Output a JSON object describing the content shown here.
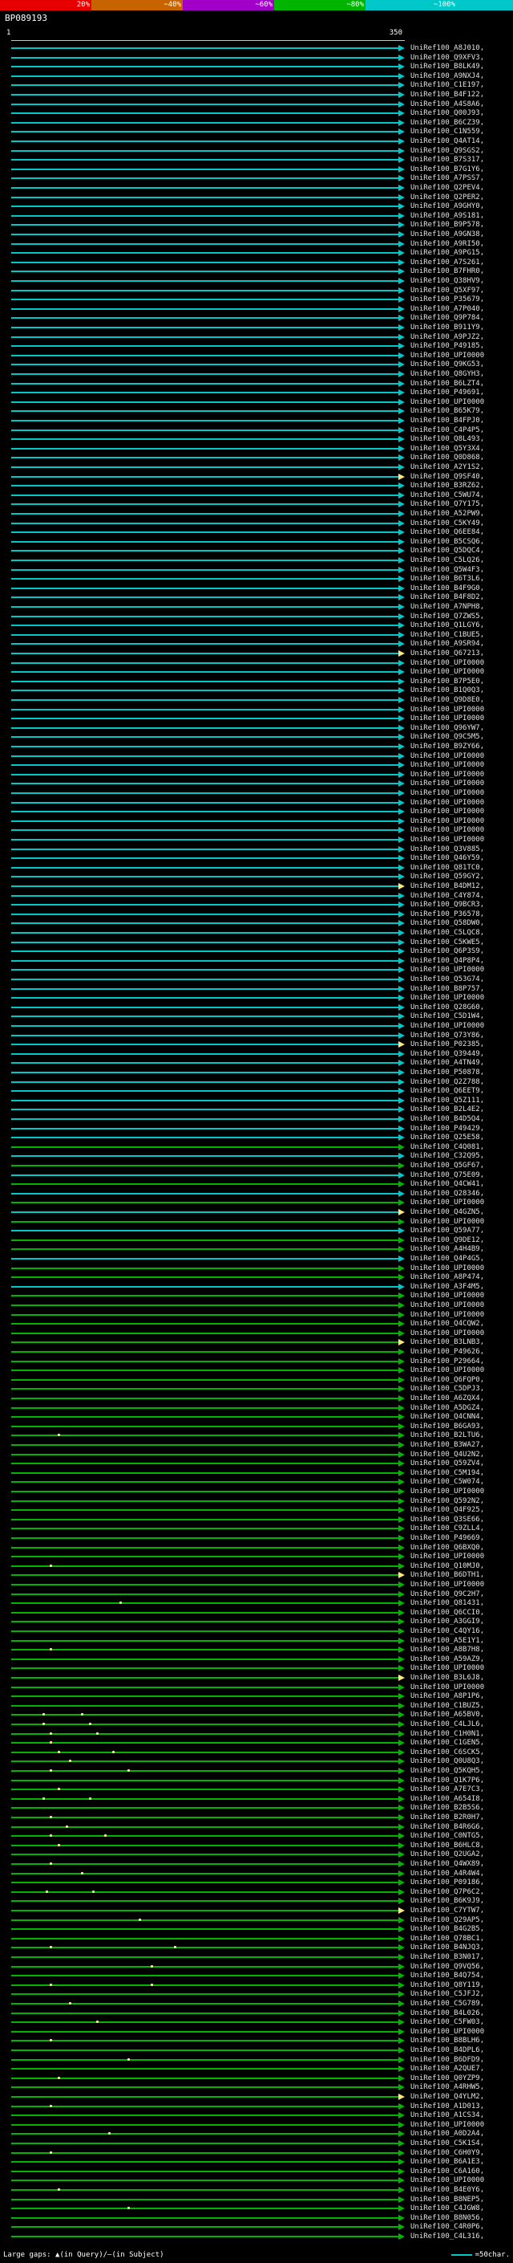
{
  "colors": {
    "c": "#00c8c8",
    "g": "#00b400",
    "highlight": "#ffe97a",
    "dot": "#f0f0a0",
    "legend_line": "#00c8c8",
    "label": "#e0e0e0"
  },
  "legend": {
    "left": "Large gaps: ▲(in Query)/—(in Subject)",
    "right_label": "=50char."
  },
  "chart_data": {
    "type": "alignment-overview",
    "query": {
      "name": "BP089193",
      "length": 350
    },
    "ruler": {
      "start": "1",
      "end": "350"
    },
    "scale": {
      "segments": [
        {
          "label": "20%",
          "color": "#e60000"
        },
        {
          "label": "~40%",
          "color": "#c86400"
        },
        {
          "label": "~60%",
          "color": "#a000c8"
        },
        {
          "label": "~80%",
          "color": "#00b400"
        },
        {
          "label": "~100%",
          "color": "#00c8c8"
        }
      ]
    },
    "hits": [
      {
        "l": "UniRef100_A8J010,",
        "t": "c"
      },
      {
        "l": "UniRef100_Q9XFV3,",
        "t": "c"
      },
      {
        "l": "UniRef100_B8LK49,",
        "t": "c"
      },
      {
        "l": "UniRef100_A9NXJ4,",
        "t": "c"
      },
      {
        "l": "UniRef100_C1E197,",
        "t": "c"
      },
      {
        "l": "UniRef100_B4F122,",
        "t": "c"
      },
      {
        "l": "UniRef100_A4S8A6,",
        "t": "c"
      },
      {
        "l": "UniRef100_Q00J93,",
        "t": "c"
      },
      {
        "l": "UniRef100_B6CZ39,",
        "t": "c"
      },
      {
        "l": "UniRef100_C1N559,",
        "t": "c"
      },
      {
        "l": "UniRef100_Q4AT14,",
        "t": "c"
      },
      {
        "l": "UniRef100_Q9SGS2,",
        "t": "c"
      },
      {
        "l": "UniRef100_B7S317,",
        "t": "c"
      },
      {
        "l": "UniRef100_B7G1Y6,",
        "t": "c"
      },
      {
        "l": "UniRef100_A7PSS7,",
        "t": "c"
      },
      {
        "l": "UniRef100_Q2PEV4,",
        "t": "c"
      },
      {
        "l": "UniRef100_Q2PER2,",
        "t": "c"
      },
      {
        "l": "UniRef100_A9GHY0,",
        "t": "c"
      },
      {
        "l": "UniRef100_A9S181,",
        "t": "c"
      },
      {
        "l": "UniRef100_B9P578,",
        "t": "c"
      },
      {
        "l": "UniRef100_A9GN38,",
        "t": "c"
      },
      {
        "l": "UniRef100_A9RI50,",
        "t": "c"
      },
      {
        "l": "UniRef100_A9PG15,",
        "t": "c"
      },
      {
        "l": "UniRef100_A7S261,",
        "t": "c"
      },
      {
        "l": "UniRef100_B7FHR0,",
        "t": "c"
      },
      {
        "l": "UniRef100_Q38HV9,",
        "t": "c"
      },
      {
        "l": "UniRef100_Q5XF97,",
        "t": "c"
      },
      {
        "l": "UniRef100_P35679,",
        "t": "c"
      },
      {
        "l": "UniRef100_A7P040,",
        "t": "c"
      },
      {
        "l": "UniRef100_Q9P784,",
        "t": "c"
      },
      {
        "l": "UniRef100_B911Y9,",
        "t": "c"
      },
      {
        "l": "UniRef100_A9PJZ2,",
        "t": "c"
      },
      {
        "l": "UniRef100_P49185,",
        "t": "c"
      },
      {
        "l": "UniRef100_UPI0000",
        "t": "c"
      },
      {
        "l": "UniRef100_Q9KG53,",
        "t": "c"
      },
      {
        "l": "UniRef100_Q8GYH3,",
        "t": "c"
      },
      {
        "l": "UniRef100_B6LZT4,",
        "t": "c"
      },
      {
        "l": "UniRef100_P49691,",
        "t": "c"
      },
      {
        "l": "UniRef100_UPI0000",
        "t": "c"
      },
      {
        "l": "UniRef100_B65K79,",
        "t": "c"
      },
      {
        "l": "UniRef100_B4FPJ0,",
        "t": "c"
      },
      {
        "l": "UniRef100_C4P4P5,",
        "t": "c"
      },
      {
        "l": "UniRef100_Q8L493,",
        "t": "c"
      },
      {
        "l": "UniRef100_Q5Y3X4,",
        "t": "c"
      },
      {
        "l": "UniRef100_Q0D868,",
        "t": "c"
      },
      {
        "l": "UniRef100_A2Y1S2,",
        "t": "c"
      },
      {
        "l": "UniRef100_Q9SF40,",
        "t": "c",
        "h": 1
      },
      {
        "l": "UniRef100_B3RZ62,",
        "t": "c"
      },
      {
        "l": "UniRef100_C5WU74,",
        "t": "c"
      },
      {
        "l": "UniRef100_Q7Y175,",
        "t": "c"
      },
      {
        "l": "UniRef100_A52PW9,",
        "t": "c"
      },
      {
        "l": "UniRef100_C5KY49,",
        "t": "c"
      },
      {
        "l": "UniRef100_Q6EE84,",
        "t": "c"
      },
      {
        "l": "UniRef100_B5CSQ6,",
        "t": "c"
      },
      {
        "l": "UniRef100_Q5DQC4,",
        "t": "c"
      },
      {
        "l": "UniRef100_C5LQ26,",
        "t": "c"
      },
      {
        "l": "UniRef100_Q5W4F3,",
        "t": "c"
      },
      {
        "l": "UniRef100_B6T3L6,",
        "t": "c"
      },
      {
        "l": "UniRef100_B4F9G0,",
        "t": "c"
      },
      {
        "l": "UniRef100_B4F8D2,",
        "t": "c"
      },
      {
        "l": "UniRef100_A7NPH8,",
        "t": "c"
      },
      {
        "l": "UniRef100_Q7ZWS5,",
        "t": "c"
      },
      {
        "l": "UniRef100_Q1LGY6,",
        "t": "c"
      },
      {
        "l": "UniRef100_C1BUE5,",
        "t": "c"
      },
      {
        "l": "UniRef100_A9SR94,",
        "t": "c"
      },
      {
        "l": "UniRef100_Q67213,",
        "t": "c",
        "h": 1
      },
      {
        "l": "UniRef100_UPI0000",
        "t": "c"
      },
      {
        "l": "UniRef100_UPI0000",
        "t": "c"
      },
      {
        "l": "UniRef100_B7P5E0,",
        "t": "c"
      },
      {
        "l": "UniRef100_B1Q0Q3,",
        "t": "c"
      },
      {
        "l": "UniRef100_Q9D8E0,",
        "t": "c"
      },
      {
        "l": "UniRef100_UPI0000",
        "t": "c"
      },
      {
        "l": "UniRef100_UPI0000",
        "t": "c"
      },
      {
        "l": "UniRef100_Q96YW7,",
        "t": "c"
      },
      {
        "l": "UniRef100_Q9C5M5,",
        "t": "c"
      },
      {
        "l": "UniRef100_B9ZY66,",
        "t": "c"
      },
      {
        "l": "UniRef100_UPI0000",
        "t": "c"
      },
      {
        "l": "UniRef100_UPI0000",
        "t": "c"
      },
      {
        "l": "UniRef100_UPI0000",
        "t": "c"
      },
      {
        "l": "UniRef100_UPI0000",
        "t": "c"
      },
      {
        "l": "UniRef100_UPI0000",
        "t": "c"
      },
      {
        "l": "UniRef100_UPI0000",
        "t": "c"
      },
      {
        "l": "UniRef100_UPI0000",
        "t": "c"
      },
      {
        "l": "UniRef100_UPI0000",
        "t": "c"
      },
      {
        "l": "UniRef100_UPI0000",
        "t": "c"
      },
      {
        "l": "UniRef100_UPI0000",
        "t": "c"
      },
      {
        "l": "UniRef100_Q3V885,",
        "t": "c"
      },
      {
        "l": "UniRef100_Q46Y59,",
        "t": "c"
      },
      {
        "l": "UniRef100_Q81TC0,",
        "t": "c"
      },
      {
        "l": "UniRef100_Q59GY2,",
        "t": "c"
      },
      {
        "l": "UniRef100_B4DM12,",
        "t": "c",
        "h": 1
      },
      {
        "l": "UniRef100_C4Y874,",
        "t": "c"
      },
      {
        "l": "UniRef100_Q9BCR3,",
        "t": "c"
      },
      {
        "l": "UniRef100_P36578,",
        "t": "c"
      },
      {
        "l": "UniRef100_Q58DW0,",
        "t": "c"
      },
      {
        "l": "UniRef100_C5LQC8,",
        "t": "c"
      },
      {
        "l": "UniRef100_C5KWE5,",
        "t": "c"
      },
      {
        "l": "UniRef100_Q6P3S9,",
        "t": "c"
      },
      {
        "l": "UniRef100_Q4P8P4,",
        "t": "c"
      },
      {
        "l": "UniRef100_UPI0000",
        "t": "c"
      },
      {
        "l": "UniRef100_Q53G74,",
        "t": "c"
      },
      {
        "l": "UniRef100_B8P757,",
        "t": "c"
      },
      {
        "l": "UniRef100_UPI0000",
        "t": "c"
      },
      {
        "l": "UniRef100_Q28G60,",
        "t": "c"
      },
      {
        "l": "UniRef100_C5D1W4,",
        "t": "c"
      },
      {
        "l": "UniRef100_UPI0000",
        "t": "c"
      },
      {
        "l": "UniRef100_Q73Y86,",
        "t": "c"
      },
      {
        "l": "UniRef100_P02385,",
        "t": "c",
        "h": 1
      },
      {
        "l": "UniRef100_Q39449,",
        "t": "c"
      },
      {
        "l": "UniRef100_A4TN49,",
        "t": "c"
      },
      {
        "l": "UniRef100_P50878,",
        "t": "c"
      },
      {
        "l": "UniRef100_Q2Z788,",
        "t": "c"
      },
      {
        "l": "UniRef100_Q6EET9,",
        "t": "c"
      },
      {
        "l": "UniRef100_Q5Z111,",
        "t": "c"
      },
      {
        "l": "UniRef100_B2L4E2,",
        "t": "c"
      },
      {
        "l": "UniRef100_B4D5Q4,",
        "t": "c"
      },
      {
        "l": "UniRef100_P49429,",
        "t": "c"
      },
      {
        "l": "UniRef100_Q25E58,",
        "t": "c"
      },
      {
        "l": "UniRef100_C4Q081,",
        "t": "g"
      },
      {
        "l": "UniRef100_C32Q95,",
        "t": "c"
      },
      {
        "l": "UniRef100_Q5GF67,",
        "t": "g"
      },
      {
        "l": "UniRef100_Q75E09,",
        "t": "c"
      },
      {
        "l": "UniRef100_Q4CW41,",
        "t": "g"
      },
      {
        "l": "UniRef100_Q28346,",
        "t": "c"
      },
      {
        "l": "UniRef100_UPI0000",
        "t": "g"
      },
      {
        "l": "UniRef100_Q4GZN5,",
        "t": "c",
        "h": 1
      },
      {
        "l": "UniRef100_UPI0000",
        "t": "g"
      },
      {
        "l": "UniRef100_Q59A77,",
        "t": "c"
      },
      {
        "l": "UniRef100_Q9DE12,",
        "t": "g"
      },
      {
        "l": "UniRef100_A4H4B9,",
        "t": "g"
      },
      {
        "l": "UniRef100_Q4P4G5,",
        "t": "c"
      },
      {
        "l": "UniRef100_UPI0000",
        "t": "g"
      },
      {
        "l": "UniRef100_A8P474,",
        "t": "g"
      },
      {
        "l": "UniRef100_A3F4M5,",
        "t": "c"
      },
      {
        "l": "UniRef100_UPI0000",
        "t": "g"
      },
      {
        "l": "UniRef100_UPI0000",
        "t": "g"
      },
      {
        "l": "UniRef100_UPI0000",
        "t": "g"
      },
      {
        "l": "UniRef100_Q4CQW2,",
        "t": "g"
      },
      {
        "l": "UniRef100_UPI0000",
        "t": "g"
      },
      {
        "l": "UniRef100_B3LNB3,",
        "t": "g",
        "h": 1
      },
      {
        "l": "UniRef100_P49626,",
        "t": "g"
      },
      {
        "l": "UniRef100_P29664,",
        "t": "g"
      },
      {
        "l": "UniRef100_UPI0000",
        "t": "g"
      },
      {
        "l": "UniRef100_Q6FQP0,",
        "t": "g"
      },
      {
        "l": "UniRef100_C5DPJ3,",
        "t": "g"
      },
      {
        "l": "UniRef100_A6ZQX4,",
        "t": "g"
      },
      {
        "l": "UniRef100_A5DGZ4,",
        "t": "g"
      },
      {
        "l": "UniRef100_Q4CNN4,",
        "t": "g"
      },
      {
        "l": "UniRef100_B6GA93,",
        "t": "g"
      },
      {
        "l": "UniRef100_B2LTU6,",
        "t": "g",
        "d": [
          0.12
        ]
      },
      {
        "l": "UniRef100_B3WA27,",
        "t": "g"
      },
      {
        "l": "UniRef100_Q4U2N2,",
        "t": "g"
      },
      {
        "l": "UniRef100_Q59ZV4,",
        "t": "g"
      },
      {
        "l": "UniRef100_C5M194,",
        "t": "g"
      },
      {
        "l": "UniRef100_C5W074,",
        "t": "g"
      },
      {
        "l": "UniRef100_UPI0000",
        "t": "g"
      },
      {
        "l": "UniRef100_Q592N2,",
        "t": "g"
      },
      {
        "l": "UniRef100_Q4F925,",
        "t": "g"
      },
      {
        "l": "UniRef100_Q3SE66,",
        "t": "g"
      },
      {
        "l": "UniRef100_C9ZLL4,",
        "t": "g"
      },
      {
        "l": "UniRef100_P49669,",
        "t": "g"
      },
      {
        "l": "UniRef100_Q6BXQ0,",
        "t": "g"
      },
      {
        "l": "UniRef100_UPI0000",
        "t": "g"
      },
      {
        "l": "UniRef100_Q10MJ0,",
        "t": "g",
        "d": [
          0.1
        ]
      },
      {
        "l": "UniRef100_B6DTH1,",
        "t": "g",
        "h": 1
      },
      {
        "l": "UniRef100_UPI0000",
        "t": "g"
      },
      {
        "l": "UniRef100_Q9C2H7,",
        "t": "g"
      },
      {
        "l": "UniRef100_Q81431,",
        "t": "g",
        "d": [
          0.28
        ]
      },
      {
        "l": "UniRef100_Q6CCI0,",
        "t": "g"
      },
      {
        "l": "UniRef100_A3GGI9,",
        "t": "g"
      },
      {
        "l": "UniRef100_C4QY16,",
        "t": "g"
      },
      {
        "l": "UniRef100_A5E1Y1,",
        "t": "g"
      },
      {
        "l": "UniRef100_A8B7H8,",
        "t": "g",
        "d": [
          0.1
        ]
      },
      {
        "l": "UniRef100_A59AZ9,",
        "t": "g"
      },
      {
        "l": "UniRef100_UPI0000",
        "t": "g"
      },
      {
        "l": "UniRef100_B3L6J8,",
        "t": "g",
        "h": 1
      },
      {
        "l": "UniRef100_UPI0000",
        "t": "g"
      },
      {
        "l": "UniRef100_A8P1P6,",
        "t": "g"
      },
      {
        "l": "UniRef100_C1BUZ5,",
        "t": "g"
      },
      {
        "l": "UniRef100_A65BV0,",
        "t": "g",
        "d": [
          0.08,
          0.18
        ]
      },
      {
        "l": "UniRef100_C4LJL6,",
        "t": "g",
        "d": [
          0.08,
          0.2
        ]
      },
      {
        "l": "UniRef100_C1H0N1,",
        "t": "g",
        "d": [
          0.1,
          0.22
        ]
      },
      {
        "l": "UniRef100_C1GEN5,",
        "t": "g",
        "d": [
          0.1
        ]
      },
      {
        "l": "UniRef100_C6SCK5,",
        "t": "g",
        "d": [
          0.12,
          0.26
        ]
      },
      {
        "l": "UniRef100_Q0U8Q3,",
        "t": "g",
        "d": [
          0.15
        ]
      },
      {
        "l": "UniRef100_Q5KQH5,",
        "t": "g",
        "d": [
          0.1,
          0.3
        ]
      },
      {
        "l": "UniRef100_Q1K7P6,",
        "t": "g"
      },
      {
        "l": "UniRef100_A7E7C3,",
        "t": "g",
        "d": [
          0.12
        ]
      },
      {
        "l": "UniRef100_A654I8,",
        "t": "g",
        "d": [
          0.08,
          0.2
        ]
      },
      {
        "l": "UniRef100_B2B5S6,",
        "t": "g"
      },
      {
        "l": "UniRef100_B2R0H7,",
        "t": "g",
        "d": [
          0.1
        ]
      },
      {
        "l": "UniRef100_B4R6G6,",
        "t": "g",
        "d": [
          0.14
        ]
      },
      {
        "l": "UniRef100_C0NTG5,",
        "t": "g",
        "d": [
          0.1,
          0.24
        ]
      },
      {
        "l": "UniRef100_B6HLC8,",
        "t": "g",
        "d": [
          0.12
        ]
      },
      {
        "l": "UniRef100_Q2UGA2,",
        "t": "g"
      },
      {
        "l": "UniRef100_Q4WX89,",
        "t": "g",
        "d": [
          0.1
        ]
      },
      {
        "l": "UniRef100_A4R4W4,",
        "t": "g",
        "d": [
          0.18
        ]
      },
      {
        "l": "UniRef100_P09186,",
        "t": "g"
      },
      {
        "l": "UniRef100_Q7P6C2,",
        "t": "g",
        "d": [
          0.09,
          0.21
        ]
      },
      {
        "l": "UniRef100_B6K9J9,",
        "t": "g"
      },
      {
        "l": "UniRef100_C7YTW7,",
        "t": "g",
        "h": 1
      },
      {
        "l": "UniRef100_Q29AP5,",
        "t": "g",
        "d": [
          0.33
        ]
      },
      {
        "l": "UniRef100_B4G2B5,",
        "t": "g"
      },
      {
        "l": "UniRef100_Q78BC1,",
        "t": "g"
      },
      {
        "l": "UniRef100_B4NJQ3,",
        "t": "g",
        "d": [
          0.1,
          0.42
        ]
      },
      {
        "l": "UniRef100_B3N017,",
        "t": "g"
      },
      {
        "l": "UniRef100_Q9VQ56,",
        "t": "g",
        "d": [
          0.36
        ]
      },
      {
        "l": "UniRef100_B4Q754,",
        "t": "g"
      },
      {
        "l": "UniRef100_Q8Y119,",
        "t": "g",
        "d": [
          0.1,
          0.36
        ]
      },
      {
        "l": "UniRef100_C5JFJ2,",
        "t": "g"
      },
      {
        "l": "UniRef100_C5G789,",
        "t": "g",
        "d": [
          0.15
        ]
      },
      {
        "l": "UniRef100_B4L026,",
        "t": "g"
      },
      {
        "l": "UniRef100_C5FW03,",
        "t": "g",
        "d": [
          0.22
        ]
      },
      {
        "l": "UniRef100_UPI0000",
        "t": "g"
      },
      {
        "l": "UniRef100_B8BLH6,",
        "t": "g",
        "d": [
          0.1
        ]
      },
      {
        "l": "UniRef100_B4DPL6,",
        "t": "g"
      },
      {
        "l": "UniRef100_B6DFD9,",
        "t": "g",
        "d": [
          0.3
        ]
      },
      {
        "l": "UniRef100_A2QUE7,",
        "t": "g"
      },
      {
        "l": "UniRef100_Q0YZP9,",
        "t": "g",
        "d": [
          0.12
        ]
      },
      {
        "l": "UniRef100_A4RHW5,",
        "t": "g"
      },
      {
        "l": "UniRef100_Q4YLM2,",
        "t": "g",
        "h": 1
      },
      {
        "l": "UniRef100_A1D013,",
        "t": "g",
        "d": [
          0.1
        ]
      },
      {
        "l": "UniRef100_A1CS34,",
        "t": "g"
      },
      {
        "l": "UniRef100_UPI0000",
        "t": "g"
      },
      {
        "l": "UniRef100_A0D2A4,",
        "t": "g",
        "d": [
          0.25
        ]
      },
      {
        "l": "UniRef100_C5K1S4,",
        "t": "g"
      },
      {
        "l": "UniRef100_C6H0Y9,",
        "t": "g",
        "d": [
          0.1
        ]
      },
      {
        "l": "UniRef100_B6A1E3,",
        "t": "g"
      },
      {
        "l": "UniRef100_C6A160,",
        "t": "g"
      },
      {
        "l": "UniRef100_UPI0000",
        "t": "g"
      },
      {
        "l": "UniRef100_B4E0Y6,",
        "t": "g",
        "d": [
          0.12
        ]
      },
      {
        "l": "UniRef100_B8NEP5,",
        "t": "g"
      },
      {
        "l": "UniRef100_C4JGW8,",
        "t": "g",
        "d": [
          0.3
        ]
      },
      {
        "l": "UniRef100_B8N056,",
        "t": "g"
      },
      {
        "l": "UniRef100_C4R0P6,",
        "t": "g"
      },
      {
        "l": "UniRef100_C4L316,",
        "t": "g"
      }
    ]
  }
}
